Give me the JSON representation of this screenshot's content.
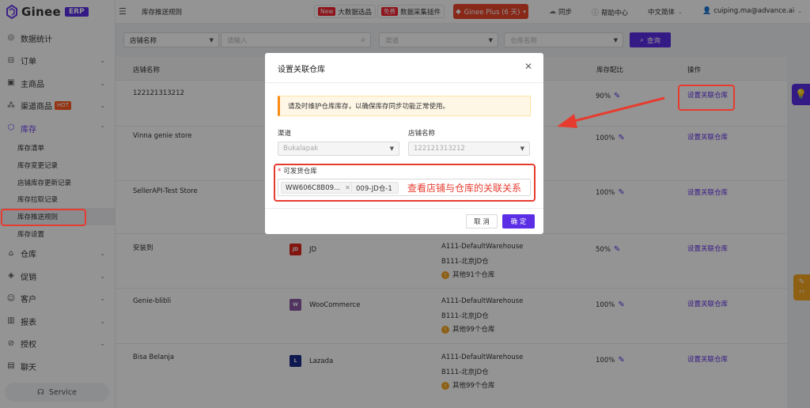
{
  "app": {
    "logo_text": "Ginee",
    "logo_badge": "ERP"
  },
  "sidebar": {
    "items": [
      {
        "label": "数据统计",
        "icon": "dashboard-icon",
        "glyph": "◎"
      },
      {
        "label": "订单",
        "icon": "cart-icon",
        "glyph": "⊟"
      },
      {
        "label": "主商品",
        "icon": "box-icon",
        "glyph": "▣"
      },
      {
        "label": "渠道商品",
        "icon": "channel-icon",
        "glyph": "⁂",
        "badge": "HOT"
      },
      {
        "label": "库存",
        "icon": "inventory-icon",
        "glyph": "⬡"
      }
    ],
    "sub_items": [
      {
        "label": "库存清单"
      },
      {
        "label": "库存变更记录"
      },
      {
        "label": "店铺库存更新记录"
      },
      {
        "label": "库存拉取记录"
      },
      {
        "label": "库存推送规则"
      },
      {
        "label": "库存设置"
      }
    ],
    "items_after": [
      {
        "label": "仓库",
        "icon": "warehouse-icon",
        "glyph": "⌂"
      },
      {
        "label": "促销",
        "icon": "tag-icon",
        "glyph": "◈"
      },
      {
        "label": "客户",
        "icon": "users-icon",
        "glyph": "☺"
      },
      {
        "label": "报表",
        "icon": "chart-icon",
        "glyph": "▥"
      },
      {
        "label": "授权",
        "icon": "link-icon",
        "glyph": "⊘"
      },
      {
        "label": "聊天",
        "icon": "chat-icon",
        "glyph": "▤"
      }
    ],
    "service": "Service"
  },
  "header": {
    "title": "库存推送规则",
    "new_tag": "New",
    "big_data": "大数据选品",
    "free_tag": "免费",
    "plugin": "数据采集插件",
    "plus": "Ginee Plus (6 天)",
    "sync": "同步",
    "help": "帮助中心",
    "lang": "中文简体",
    "user": "cuiping.ma@advance.ai"
  },
  "filter": {
    "store_field": "店铺名称",
    "input_placeholder": "请输入",
    "channel_placeholder": "渠道",
    "warehouse_placeholder": "仓库名称",
    "search": "查询"
  },
  "table": {
    "headers": {
      "store": "店铺名称",
      "ratio": "库存配比",
      "action": "操作"
    },
    "action_label": "设置关联仓库",
    "more_label_91": "其他91个仓库",
    "more_label_99": "其他99个仓库",
    "rows": [
      {
        "store": "122121313212",
        "ratio": "90%"
      },
      {
        "store": "Vinna genie store",
        "ratio": "100%"
      },
      {
        "store": "SellerAPI-Test Store",
        "ratio": "100%"
      },
      {
        "store": "安装到",
        "channel": "JD",
        "wh1": "A111-DefaultWarehouse",
        "wh2": "B111-北京JD仓",
        "more": "其他91个仓库",
        "ratio": "50%"
      },
      {
        "store": "Genie-blibli",
        "channel": "WooCommerce",
        "wh1": "A111-DefaultWarehouse",
        "wh2": "B111-北京JD仓",
        "more": "其他99个仓库",
        "ratio": "100%"
      },
      {
        "store": "Bisa Belanja",
        "channel": "Lazada",
        "wh1": "A111-DefaultWarehouse",
        "wh2": "B111-北京JD仓",
        "more": "其他99个仓库",
        "ratio": "100%"
      }
    ]
  },
  "modal": {
    "title": "设置关联仓库",
    "alert": "请及时维护仓库库存，以确保库存同步功能正常使用。",
    "channel_label": "渠道",
    "channel_value": "Bukalapak",
    "store_label": "店铺名称",
    "store_value": "122121313212",
    "warehouse_label": "可发货仓库",
    "chip1": "WW606C8B09...",
    "chip2": "009-JD仓-1",
    "annotation": "查看店铺与仓库的关联关系",
    "cancel": "取 消",
    "ok": "确 定"
  }
}
